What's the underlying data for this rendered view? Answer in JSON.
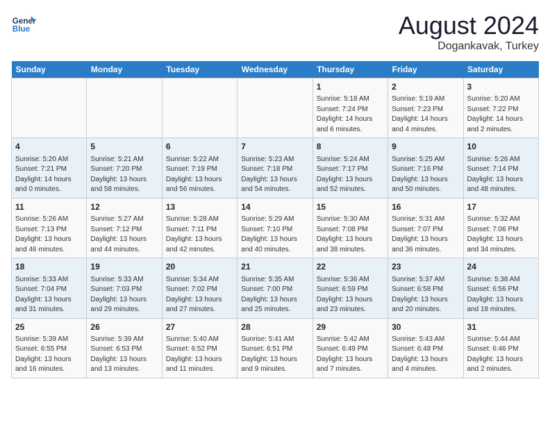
{
  "header": {
    "logo_line1": "General",
    "logo_line2": "Blue",
    "month": "August 2024",
    "location": "Dogankavak, Turkey"
  },
  "weekdays": [
    "Sunday",
    "Monday",
    "Tuesday",
    "Wednesday",
    "Thursday",
    "Friday",
    "Saturday"
  ],
  "rows": [
    [
      {
        "day": "",
        "info": ""
      },
      {
        "day": "",
        "info": ""
      },
      {
        "day": "",
        "info": ""
      },
      {
        "day": "",
        "info": ""
      },
      {
        "day": "1",
        "info": "Sunrise: 5:18 AM\nSunset: 7:24 PM\nDaylight: 14 hours\nand 6 minutes."
      },
      {
        "day": "2",
        "info": "Sunrise: 5:19 AM\nSunset: 7:23 PM\nDaylight: 14 hours\nand 4 minutes."
      },
      {
        "day": "3",
        "info": "Sunrise: 5:20 AM\nSunset: 7:22 PM\nDaylight: 14 hours\nand 2 minutes."
      }
    ],
    [
      {
        "day": "4",
        "info": "Sunrise: 5:20 AM\nSunset: 7:21 PM\nDaylight: 14 hours\nand 0 minutes."
      },
      {
        "day": "5",
        "info": "Sunrise: 5:21 AM\nSunset: 7:20 PM\nDaylight: 13 hours\nand 58 minutes."
      },
      {
        "day": "6",
        "info": "Sunrise: 5:22 AM\nSunset: 7:19 PM\nDaylight: 13 hours\nand 56 minutes."
      },
      {
        "day": "7",
        "info": "Sunrise: 5:23 AM\nSunset: 7:18 PM\nDaylight: 13 hours\nand 54 minutes."
      },
      {
        "day": "8",
        "info": "Sunrise: 5:24 AM\nSunset: 7:17 PM\nDaylight: 13 hours\nand 52 minutes."
      },
      {
        "day": "9",
        "info": "Sunrise: 5:25 AM\nSunset: 7:16 PM\nDaylight: 13 hours\nand 50 minutes."
      },
      {
        "day": "10",
        "info": "Sunrise: 5:26 AM\nSunset: 7:14 PM\nDaylight: 13 hours\nand 48 minutes."
      }
    ],
    [
      {
        "day": "11",
        "info": "Sunrise: 5:26 AM\nSunset: 7:13 PM\nDaylight: 13 hours\nand 46 minutes."
      },
      {
        "day": "12",
        "info": "Sunrise: 5:27 AM\nSunset: 7:12 PM\nDaylight: 13 hours\nand 44 minutes."
      },
      {
        "day": "13",
        "info": "Sunrise: 5:28 AM\nSunset: 7:11 PM\nDaylight: 13 hours\nand 42 minutes."
      },
      {
        "day": "14",
        "info": "Sunrise: 5:29 AM\nSunset: 7:10 PM\nDaylight: 13 hours\nand 40 minutes."
      },
      {
        "day": "15",
        "info": "Sunrise: 5:30 AM\nSunset: 7:08 PM\nDaylight: 13 hours\nand 38 minutes."
      },
      {
        "day": "16",
        "info": "Sunrise: 5:31 AM\nSunset: 7:07 PM\nDaylight: 13 hours\nand 36 minutes."
      },
      {
        "day": "17",
        "info": "Sunrise: 5:32 AM\nSunset: 7:06 PM\nDaylight: 13 hours\nand 34 minutes."
      }
    ],
    [
      {
        "day": "18",
        "info": "Sunrise: 5:33 AM\nSunset: 7:04 PM\nDaylight: 13 hours\nand 31 minutes."
      },
      {
        "day": "19",
        "info": "Sunrise: 5:33 AM\nSunset: 7:03 PM\nDaylight: 13 hours\nand 29 minutes."
      },
      {
        "day": "20",
        "info": "Sunrise: 5:34 AM\nSunset: 7:02 PM\nDaylight: 13 hours\nand 27 minutes."
      },
      {
        "day": "21",
        "info": "Sunrise: 5:35 AM\nSunset: 7:00 PM\nDaylight: 13 hours\nand 25 minutes."
      },
      {
        "day": "22",
        "info": "Sunrise: 5:36 AM\nSunset: 6:59 PM\nDaylight: 13 hours\nand 23 minutes."
      },
      {
        "day": "23",
        "info": "Sunrise: 5:37 AM\nSunset: 6:58 PM\nDaylight: 13 hours\nand 20 minutes."
      },
      {
        "day": "24",
        "info": "Sunrise: 5:38 AM\nSunset: 6:56 PM\nDaylight: 13 hours\nand 18 minutes."
      }
    ],
    [
      {
        "day": "25",
        "info": "Sunrise: 5:39 AM\nSunset: 6:55 PM\nDaylight: 13 hours\nand 16 minutes."
      },
      {
        "day": "26",
        "info": "Sunrise: 5:39 AM\nSunset: 6:53 PM\nDaylight: 13 hours\nand 13 minutes."
      },
      {
        "day": "27",
        "info": "Sunrise: 5:40 AM\nSunset: 6:52 PM\nDaylight: 13 hours\nand 11 minutes."
      },
      {
        "day": "28",
        "info": "Sunrise: 5:41 AM\nSunset: 6:51 PM\nDaylight: 13 hours\nand 9 minutes."
      },
      {
        "day": "29",
        "info": "Sunrise: 5:42 AM\nSunset: 6:49 PM\nDaylight: 13 hours\nand 7 minutes."
      },
      {
        "day": "30",
        "info": "Sunrise: 5:43 AM\nSunset: 6:48 PM\nDaylight: 13 hours\nand 4 minutes."
      },
      {
        "day": "31",
        "info": "Sunrise: 5:44 AM\nSunset: 6:46 PM\nDaylight: 13 hours\nand 2 minutes."
      }
    ]
  ]
}
